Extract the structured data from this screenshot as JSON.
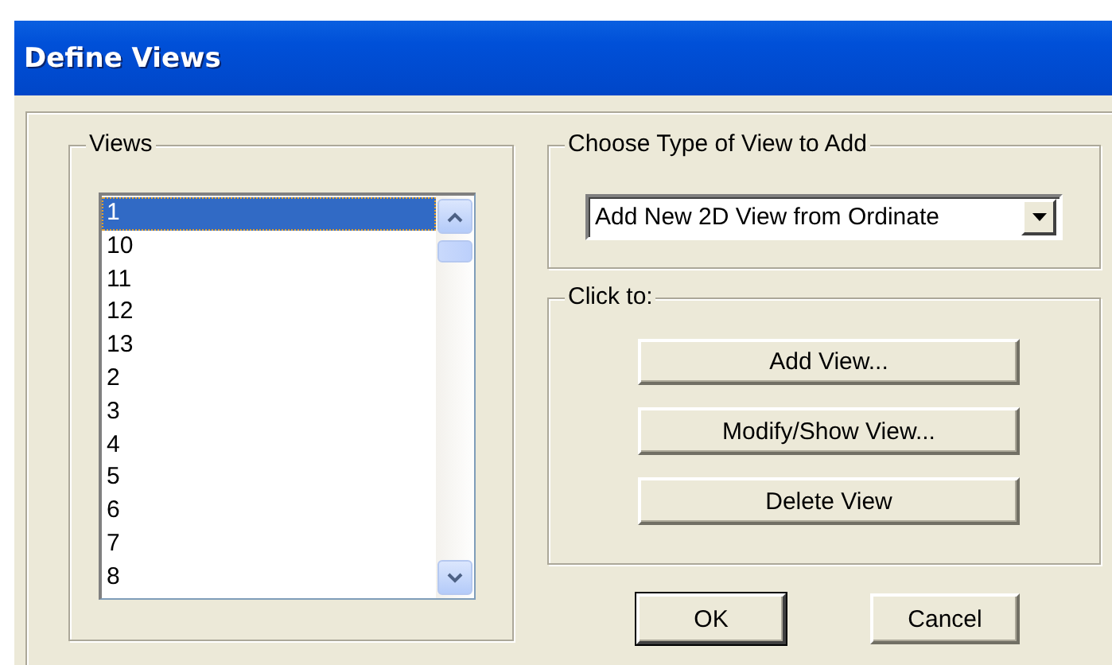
{
  "window": {
    "title": "Define Views"
  },
  "views": {
    "label": "Views",
    "items": [
      {
        "label": "1",
        "selected": true
      },
      {
        "label": "10",
        "selected": false
      },
      {
        "label": "11",
        "selected": false
      },
      {
        "label": "12",
        "selected": false
      },
      {
        "label": "13",
        "selected": false
      },
      {
        "label": "2",
        "selected": false
      },
      {
        "label": "3",
        "selected": false
      },
      {
        "label": "4",
        "selected": false
      },
      {
        "label": "5",
        "selected": false
      },
      {
        "label": "6",
        "selected": false
      },
      {
        "label": "7",
        "selected": false
      },
      {
        "label": "8",
        "selected": false
      }
    ]
  },
  "view_type": {
    "label": "Choose Type of View to Add",
    "value": "Add New 2D View from Ordinate"
  },
  "click_to": {
    "label": "Click to:",
    "buttons": [
      {
        "label": "Add View..."
      },
      {
        "label": "Modify/Show View..."
      },
      {
        "label": "Delete View"
      }
    ]
  },
  "buttons": [
    {
      "label": "OK",
      "default": true
    },
    {
      "label": "Cancel",
      "default": false
    }
  ]
}
